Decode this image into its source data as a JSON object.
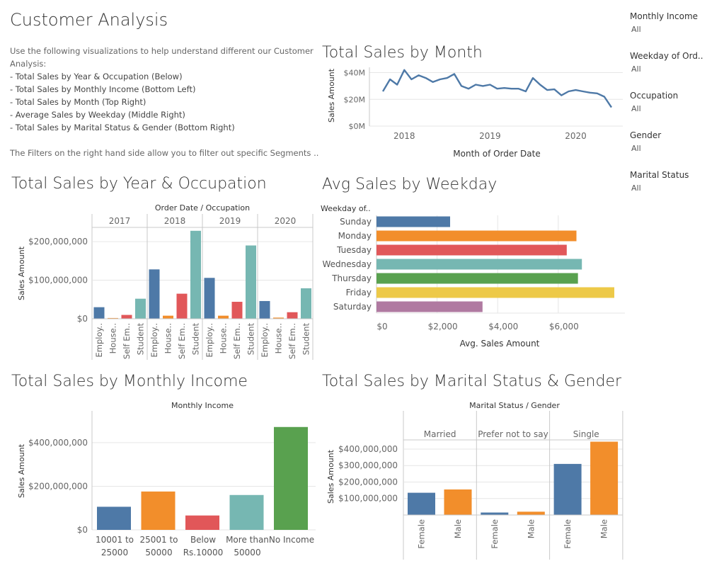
{
  "page": {
    "title": "Customer Analysis",
    "description": {
      "intro": "Use the following visualizations to help understand different our Customer Analysis:",
      "intro_line1": "Use the following visualizations to help understand different our Customer",
      "intro_line2": "Analysis:",
      "bullets": [
        "- Total Sales by Year & Occupation (Below)",
        "- Total Sales by Monthly Income (Bottom Left)",
        "- Total Sales by Month (Top Right)",
        "- Average Sales by Weekday (Middle Right)",
        "- Total Sales by Marital Status & Gender (Bottom Right)"
      ],
      "filters_note": "The Filters on the right hand side allow you to filter out specific Segments .."
    }
  },
  "filters": [
    {
      "label": "Monthly Income",
      "value": "All"
    },
    {
      "label": "Weekday of Ord..",
      "value": "All"
    },
    {
      "label": "Occupation",
      "value": "All"
    },
    {
      "label": "Gender",
      "value": "All"
    },
    {
      "label": "Marital Status",
      "value": "All"
    }
  ],
  "colors": {
    "blue": "#4e79a7",
    "orange": "#f28e2b",
    "red": "#e15759",
    "teal": "#76b7b2",
    "green": "#59a14f",
    "yellow": "#edc948",
    "purple": "#b07aa1",
    "grid": "#e6e6e6",
    "axis": "#c8c8c8"
  },
  "chart_data": [
    {
      "id": "monthly",
      "type": "line",
      "title": "Total Sales by Month",
      "xlabel": "Month of Order Date",
      "ylabel": "Sales Amount",
      "x_ticks": [
        "2018",
        "2019",
        "2020"
      ],
      "y_ticks": [
        "$0M",
        "$20M",
        "$40M"
      ],
      "y_tick_values": [
        0,
        20,
        40
      ],
      "ylim": [
        0,
        44
      ],
      "x": [
        "2017-10",
        "2017-11",
        "2017-12",
        "2018-01",
        "2018-02",
        "2018-03",
        "2018-04",
        "2018-05",
        "2018-06",
        "2018-07",
        "2018-08",
        "2018-09",
        "2018-10",
        "2018-11",
        "2018-12",
        "2019-01",
        "2019-02",
        "2019-03",
        "2019-04",
        "2019-05",
        "2019-06",
        "2019-07",
        "2019-08",
        "2019-09",
        "2019-10",
        "2019-11",
        "2019-12",
        "2020-01",
        "2020-02",
        "2020-03",
        "2020-04",
        "2020-05",
        "2020-06"
      ],
      "values": [
        26,
        35,
        31,
        42,
        35,
        38,
        36,
        33,
        35,
        36,
        39,
        30,
        28,
        31,
        30,
        31,
        28,
        28.5,
        28,
        28,
        26,
        36,
        31,
        27,
        27.5,
        23,
        26,
        27,
        26,
        25,
        24.5,
        22,
        14
      ],
      "series": [
        {
          "name": "Sales Amount"
        }
      ]
    },
    {
      "id": "year_occupation",
      "type": "bar",
      "title": "Total Sales by Year & Occupation",
      "header": "Order Date  /  Occupation",
      "ylabel": "Sales Amount",
      "years": [
        "2017",
        "2018",
        "2019",
        "2020"
      ],
      "categories": [
        "Employ..",
        "House..",
        "Self Em..",
        "Student"
      ],
      "y_ticks": [
        "$0",
        "$100,000,000",
        "$200,000,000"
      ],
      "y_tick_values": [
        0,
        100000000,
        200000000
      ],
      "ylim": [
        0,
        235000000
      ],
      "series": [
        {
          "year": "2017",
          "values": [
            30000000,
            2000000,
            10000000,
            52000000
          ]
        },
        {
          "year": "2018",
          "values": [
            128000000,
            8000000,
            65000000,
            228000000
          ]
        },
        {
          "year": "2019",
          "values": [
            106000000,
            8000000,
            44000000,
            190000000
          ]
        },
        {
          "year": "2020",
          "values": [
            46000000,
            3000000,
            17000000,
            79000000
          ]
        }
      ]
    },
    {
      "id": "weekday",
      "type": "bar",
      "orientation": "horizontal",
      "title": "Avg Sales by Weekday",
      "header": "Weekday of..",
      "xlabel": "Avg. Sales Amount",
      "categories": [
        "Sunday",
        "Monday",
        "Tuesday",
        "Wednesday",
        "Thursday",
        "Friday",
        "Saturday"
      ],
      "values": [
        2430,
        6600,
        6280,
        6780,
        6650,
        7850,
        3500
      ],
      "x_ticks": [
        "$0",
        "$2,000",
        "$4,000",
        "$6,000"
      ],
      "x_tick_values": [
        0,
        2000,
        4000,
        6000
      ],
      "xlim": [
        0,
        8200
      ]
    },
    {
      "id": "income",
      "type": "bar",
      "title": "Total Sales by Monthly Income",
      "header": "Monthly Income",
      "ylabel": "Sales Amount",
      "categories": [
        [
          "10001 to",
          "25000"
        ],
        [
          "25001 to",
          "50000"
        ],
        [
          "Below",
          "Rs.10000"
        ],
        [
          "More than",
          "50000"
        ],
        [
          "No Income"
        ]
      ],
      "values": [
        106000000,
        176000000,
        66000000,
        160000000,
        472000000
      ],
      "y_ticks": [
        "$0",
        "$200,000,000",
        "$400,000,000"
      ],
      "y_tick_values": [
        0,
        200000000,
        400000000
      ],
      "ylim": [
        0,
        520000000
      ]
    },
    {
      "id": "marital",
      "type": "bar",
      "title": "Total Sales by Marital Status & Gender",
      "header": "Marital Status  /  Gender",
      "ylabel": "Sales Amount",
      "groups": [
        "Married",
        "Prefer not to say",
        "Single"
      ],
      "categories": [
        "Female",
        "Male"
      ],
      "y_ticks": [
        "$100,000,000",
        "$200,000,000",
        "$300,000,000",
        "$400,000,000"
      ],
      "y_tick_values": [
        100000000,
        200000000,
        300000000,
        400000000
      ],
      "ylim": [
        0,
        460000000
      ],
      "series": [
        {
          "group": "Married",
          "values": [
            135000000,
            155000000
          ]
        },
        {
          "group": "Prefer not to say",
          "values": [
            15000000,
            20000000
          ]
        },
        {
          "group": "Single",
          "values": [
            310000000,
            445000000
          ]
        }
      ]
    }
  ]
}
